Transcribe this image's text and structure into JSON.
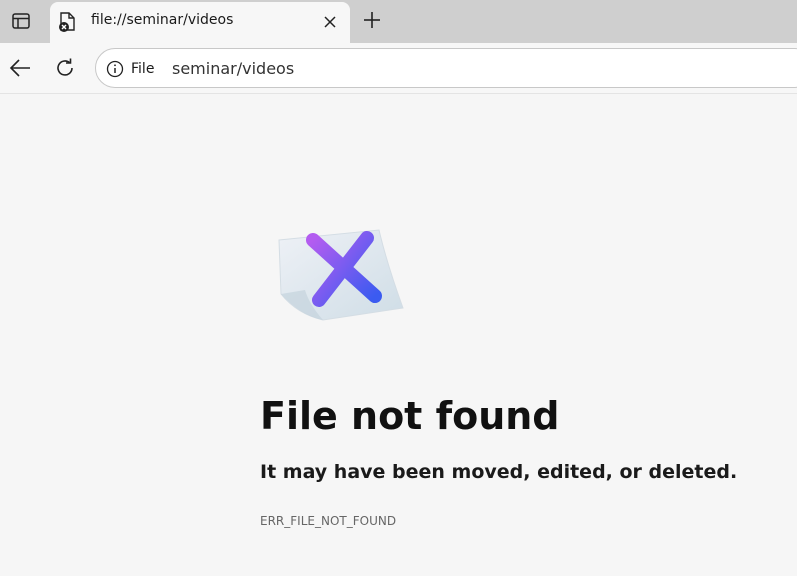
{
  "tab": {
    "title": "file://seminar/videos"
  },
  "toolbar": {
    "site_info_label": "File",
    "url": "seminar/videos"
  },
  "error": {
    "title": "File not found",
    "subtitle": "It may have been moved, edited, or deleted.",
    "code": "ERR_FILE_NOT_FOUND"
  },
  "icons": {
    "sidebar_toggle": "sidebar-toggle-icon",
    "favicon": "file-error-icon",
    "close": "close-icon",
    "new_tab": "plus-icon",
    "back": "back-arrow-icon",
    "reload": "reload-icon",
    "site_info": "info-icon",
    "illustration": "file-x-illustration"
  },
  "colors": {
    "tab_strip": "#cfcfcf",
    "page_background": "#f6f6f6",
    "x_gradient_start": "#b35cf0",
    "x_gradient_end": "#3b5bf0"
  }
}
